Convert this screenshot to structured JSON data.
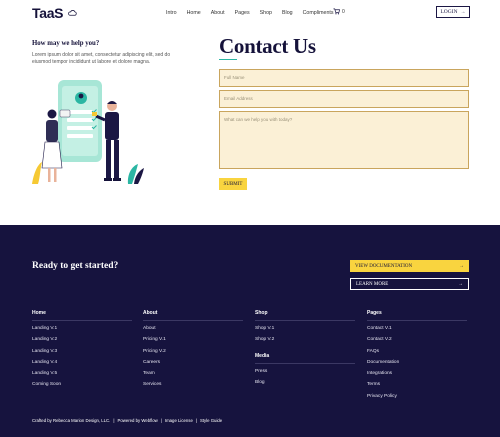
{
  "header": {
    "logo": "TaaS",
    "nav": [
      "Intro",
      "Home",
      "About",
      "Pages",
      "Shop",
      "Blog",
      "Compliments"
    ],
    "cart_count": "0",
    "login_label": "LOGIN",
    "login_icon": "arrow-right-icon"
  },
  "help": {
    "title": "How may we help you?",
    "text": "Lorem ipsum dolor sit amet, consectetur adipiscing elit, sed do eiusmod tempor incididunt ut labore et dolore magna."
  },
  "contact": {
    "title": "Contact Us",
    "name_placeholder": "Full Name",
    "email_placeholder": "Email Address",
    "message_placeholder": "What can we help you with today?",
    "submit_label": "SUBMIT"
  },
  "footer": {
    "ready": "Ready to get started?",
    "cta_docs": "VIEW DOCUMENTATION",
    "cta_learn": "LEARN MORE",
    "columns": {
      "home": {
        "title": "Home",
        "links": [
          "Landing V.1",
          "Landing V.2",
          "Landing V.3",
          "Landing V.4",
          "Landing V.5",
          "Coming Soon"
        ]
      },
      "about": {
        "title": "About",
        "links": [
          "About",
          "Pricing V.1",
          "Pricing V.2",
          "Careers",
          "Team",
          "Services"
        ]
      },
      "shop": {
        "title": "Shop",
        "links": [
          "Shop V.1",
          "Shop V.2"
        ]
      },
      "media": {
        "title": "Media",
        "links": [
          "Press",
          "Blog"
        ]
      },
      "pages": {
        "title": "Pages",
        "links": [
          "Contact V.1",
          "Contact V.2",
          "FAQs",
          "Documentation",
          "Integrations",
          "Terms",
          "Privacy Policy"
        ]
      }
    },
    "credits": [
      "Crafted by Rebecca Marion Design, LLC.",
      "Powered by Webflow",
      "Image License",
      "Style Guide"
    ]
  },
  "colors": {
    "navy": "#16133e",
    "yellow": "#f9d43f",
    "teal": "#2bb6a3",
    "field_bg": "#fbf0d6"
  }
}
